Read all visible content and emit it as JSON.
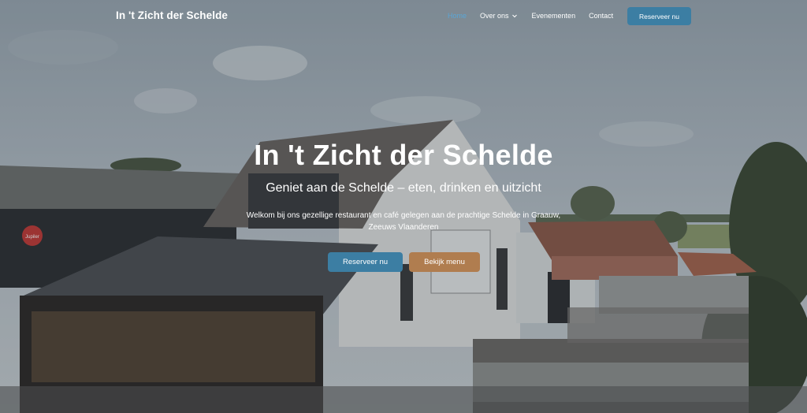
{
  "nav": {
    "brand": "In 't Zicht der Schelde",
    "items": [
      {
        "label": "Home",
        "active": true
      },
      {
        "label": "Over ons",
        "has_dropdown": true
      },
      {
        "label": "Evenementen"
      },
      {
        "label": "Contact"
      }
    ],
    "cta_label": "Reserveer nu",
    "chevron_icon": "chevron-down-icon"
  },
  "hero": {
    "title": "In 't Zicht der Schelde",
    "subtitle": "Geniet aan de Schelde – eten, drinken en uitzicht",
    "description": "Welkom bij ons gezellige restaurant en café gelegen aan de prachtige Schelde in Graauw, Zeeuws Vlaanderen",
    "primary_button": "Reserveer nu",
    "secondary_button": "Bekijk menu",
    "background": "photo of a white café building with dark roofed terrace, grey sky",
    "sign_text": "Jupiler"
  },
  "colors": {
    "accent": "#3c7ea3",
    "accent_light": "#5aa6d6",
    "secondary": "#b07d4f"
  }
}
